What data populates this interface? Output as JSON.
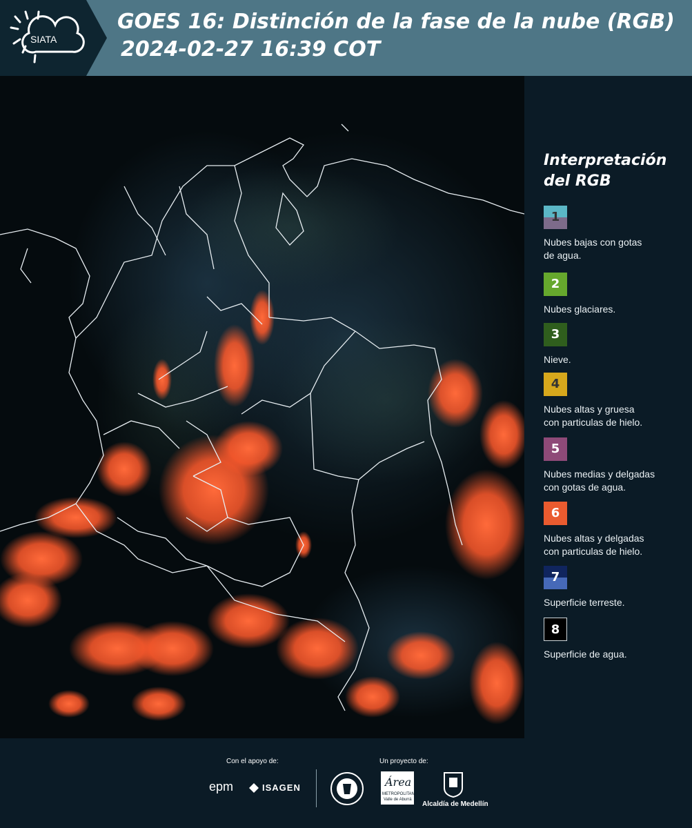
{
  "header": {
    "logo_text": "SIATA",
    "title_line1": "GOES 16: Distinción de la fase de la nube (RGB)",
    "title_line2": "2024-02-27 16:39 COT"
  },
  "legend": {
    "title_line1": "Interpretación",
    "title_line2": "del RGB",
    "items": [
      {
        "number": "1",
        "label_l1": "Nubes bajas con gotas",
        "label_l2": "de agua.",
        "color_top": "#5bb7c6",
        "color_bottom": "#7d6b8a",
        "text_color": "#333"
      },
      {
        "number": "2",
        "label_l1": "Nubes glaciares.",
        "label_l2": "",
        "color_top": "#66a82d",
        "color_bottom": "#66a82d",
        "text_color": "#fff"
      },
      {
        "number": "3",
        "label_l1": "Nieve.",
        "label_l2": "",
        "color_top": "#2f5e1d",
        "color_bottom": "#2f5e1d",
        "text_color": "#fff"
      },
      {
        "number": "4",
        "label_l1": "Nubes altas y gruesa",
        "label_l2": "con particulas de hielo.",
        "color_top": "#d7a81c",
        "color_bottom": "#d7a81c",
        "text_color": "#333"
      },
      {
        "number": "5",
        "label_l1": "Nubes medias y delgadas",
        "label_l2": "con gotas de agua.",
        "color_top": "#8e4a78",
        "color_bottom": "#8e4a78",
        "text_color": "#fff"
      },
      {
        "number": "6",
        "label_l1": "Nubes altas y delgadas",
        "label_l2": "con particulas de hielo.",
        "color_top": "#ea5b2f",
        "color_bottom": "#ea5b2f",
        "text_color": "#fff"
      },
      {
        "number": "7",
        "label_l1": "Superficie terreste.",
        "label_l2": "",
        "color_top": "#10255e",
        "color_bottom": "#4669b8",
        "text_color": "#fff"
      },
      {
        "number": "8",
        "label_l1": "Superficie de agua.",
        "label_l2": "",
        "color_top": "#000000",
        "color_bottom": "#000000",
        "text_color": "#fff"
      }
    ]
  },
  "footer": {
    "support_label": "Con el apoyo de:",
    "project_label": "Un proyecto de:",
    "sponsor_epm": "epm",
    "sponsor_isagen": "ISAGEN",
    "area_logo_name": "Área",
    "area_logo_sub1": "METROPOLITANA",
    "area_logo_sub2": "Valle de Aburrá",
    "alcaldia": "Alcaldía de Medellín"
  }
}
